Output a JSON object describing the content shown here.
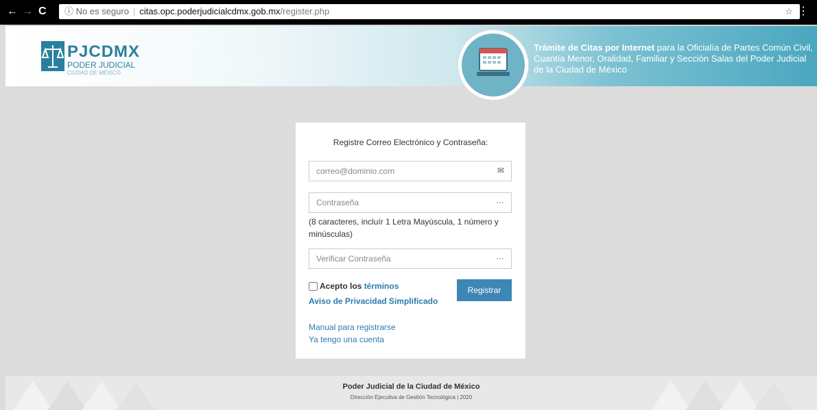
{
  "browser": {
    "back": "←",
    "forward": "→",
    "reload": "C",
    "security": "ⓘ No es seguro",
    "host": "citas.opc.poderjudicialcdmx.gob.mx",
    "path": "/register.php",
    "star": "☆",
    "menu": "⋮"
  },
  "header": {
    "logo_brand": "PJCDMX",
    "logo_sub1": "PODER JUDICIAL",
    "logo_sub2": "CIUDAD DE MÉXICO",
    "tagline_bold": "Trámite de Citas por Internet",
    "tagline_rest": " para la Oficialía de Partes Común Civil, Cuantía Menor, Oralidad, Familiar y Sección Salas del Poder Judicial de la Ciudad de México",
    "calendar_icon": "calendar-icon"
  },
  "form": {
    "title": "Registre Correo Electrónico y Contraseña:",
    "email_placeholder": "correo@dominio.com",
    "email_icon": "✉",
    "password_placeholder": "Contraseña",
    "password_icon": "···",
    "hint": "(8 caracteres, incluír 1 Letra Mayúscula, 1 número y minúsculas)",
    "verify_placeholder": "Verificar Contraseña",
    "verify_icon": "···",
    "accept_prefix": "Acepto los ",
    "terms_link": "términos",
    "privacy_link": "Aviso de Privacidad Simplificado",
    "submit_label": "Registrar",
    "manual_link": "Manual para registrarse",
    "login_link": "Ya tengo una cuenta"
  },
  "footer": {
    "title": "Poder Judicial de la Ciudad de México",
    "subtitle": "Dirección Ejecutiva de Gestión Tecnológica  |  2020"
  },
  "colors": {
    "primary": "#3e86b6",
    "link": "#2b7ab0",
    "banner": "#4aa7bf"
  }
}
